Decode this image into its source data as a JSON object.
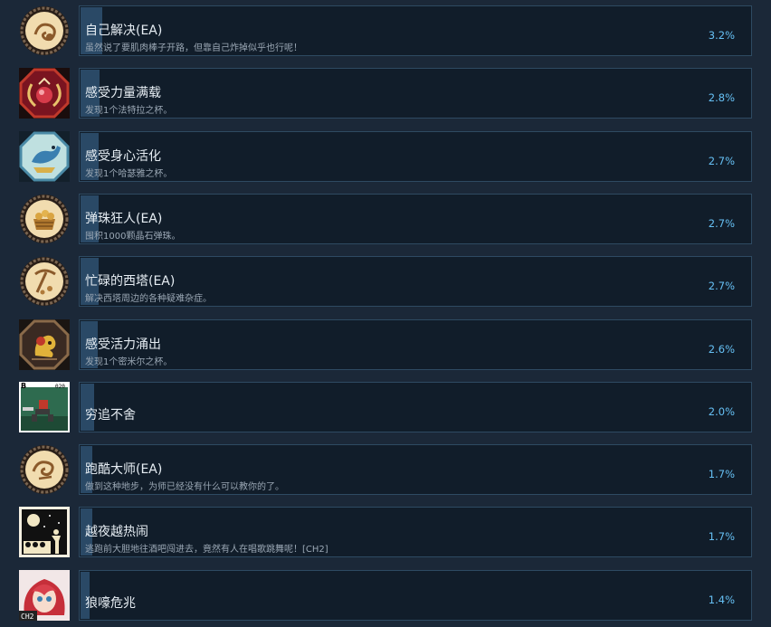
{
  "achievements": [
    {
      "title": "自己解决(EA)",
      "description": "虽然说了要肌肉棒子开路，但靠自己炸掉似乎也行呢！",
      "percent": "3.2%",
      "rate": 3.2,
      "icon": "cookie-medal-icon"
    },
    {
      "title": "感受力量满载",
      "description": "发现1个法特拉之杯。",
      "percent": "2.8%",
      "rate": 2.8,
      "icon": "red-orb-icon"
    },
    {
      "title": "感受身心活化",
      "description": "发现1个哈瑟雅之杯。",
      "percent": "2.7%",
      "rate": 2.7,
      "icon": "blue-bird-icon"
    },
    {
      "title": "弹珠狂人(EA)",
      "description": "囤积1000颗晶石弹珠。",
      "percent": "2.7%",
      "rate": 2.7,
      "icon": "treasure-basket-icon"
    },
    {
      "title": "忙碌的西塔(EA)",
      "description": "解决西塔周边的各种疑难杂症。",
      "percent": "2.7%",
      "rate": 2.7,
      "icon": "pickaxe-medal-icon"
    },
    {
      "title": "感受活力涌出",
      "description": "发现1个密米尔之杯。",
      "percent": "2.6%",
      "rate": 2.6,
      "icon": "golden-creature-icon"
    },
    {
      "title": "穷追不舍",
      "description": "",
      "percent": "2.0%",
      "rate": 2.0,
      "icon": "pixel-runner-icon",
      "icon_text": [
        "B",
        "020"
      ]
    },
    {
      "title": "跑酷大师(EA)",
      "description": "做到这种地步，为师已经没有什么可以教你的了。",
      "percent": "1.7%",
      "rate": 1.7,
      "icon": "swirl-medal-icon"
    },
    {
      "title": "越夜越热闹",
      "description": "逃跑前大胆地往酒吧闯进去，竟然有人在唱歌跳舞呢！[CH2]",
      "percent": "1.7%",
      "rate": 1.7,
      "icon": "night-moon-icon"
    },
    {
      "title": "狼嚎危兆",
      "description": "",
      "percent": "1.4%",
      "rate": 1.4,
      "icon": "red-hair-girl-icon",
      "icon_text": [
        "CH2"
      ]
    }
  ],
  "colors": {
    "background": "#1b2838",
    "panel": "#111d2a",
    "panel_border": "#2e4a62",
    "progress": "#2a4966",
    "percent_text": "#66c0f4"
  }
}
